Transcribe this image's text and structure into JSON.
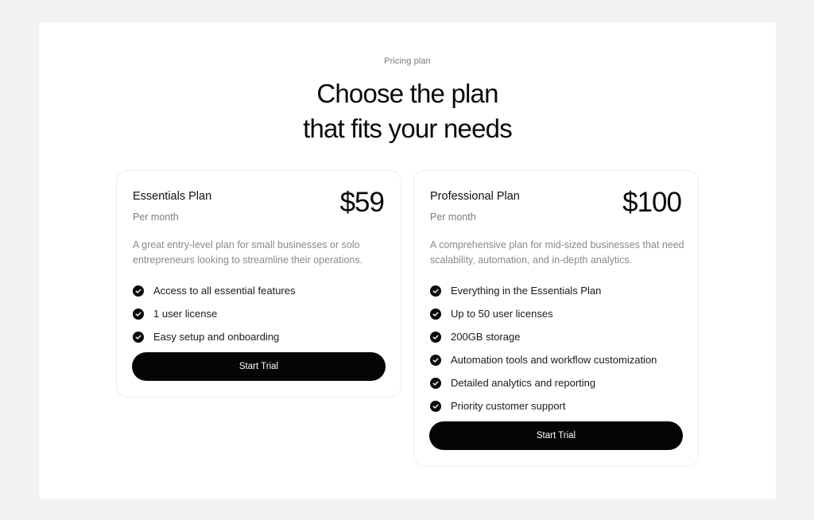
{
  "header": {
    "eyebrow": "Pricing plan",
    "title_line1": "Choose the plan",
    "title_line2": "that fits your needs"
  },
  "plans": [
    {
      "name": "Essentials Plan",
      "period": "Per month",
      "price": "$59",
      "description": "A great entry-level plan for small businesses or solo entrepreneurs looking to streamline their operations.",
      "features": [
        "Access to all essential features",
        "1 user license",
        "Easy setup and onboarding"
      ],
      "cta": "Start Trial"
    },
    {
      "name": "Professional Plan",
      "period": "Per month",
      "price": "$100",
      "description": "A comprehensive plan for mid-sized businesses that need scalability, automation, and in-depth analytics.",
      "features": [
        "Everything in the Essentials Plan",
        "Up to 50 user licenses",
        "200GB storage",
        "Automation tools and workflow customization",
        "Detailed analytics and reporting",
        "Priority customer support"
      ],
      "cta": "Start Trial"
    }
  ],
  "icons": {
    "feature_check": "check-circle-icon"
  },
  "colors": {
    "page_background": "#f2f2f2",
    "panel_background": "#ffffff",
    "button_background": "#050505",
    "muted_text": "#8a8a8a"
  }
}
